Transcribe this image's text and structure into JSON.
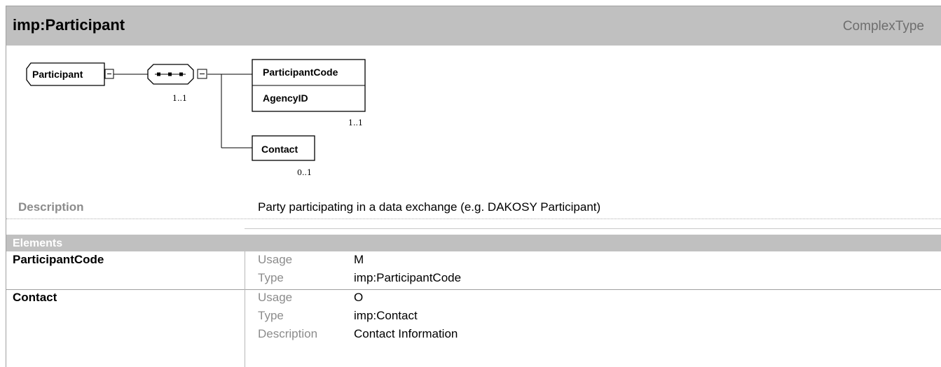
{
  "header": {
    "title": "imp:Participant",
    "kind": "ComplexType"
  },
  "diagram": {
    "root_label": "Participant",
    "sequence_cardinality": "1..1",
    "group_items": [
      "ParticipantCode",
      "AgencyID"
    ],
    "group_cardinality": "1..1",
    "contact_label": "Contact",
    "contact_cardinality": "0..1"
  },
  "description": {
    "label": "Description",
    "text": "Party participating in a data exchange (e.g. DAKOSY Participant)"
  },
  "elements": {
    "heading": "Elements",
    "rows": [
      {
        "name": "ParticipantCode",
        "props": [
          {
            "key": "Usage",
            "value": "M"
          },
          {
            "key": "Type",
            "value": "imp:ParticipantCode"
          }
        ]
      },
      {
        "name": "Contact",
        "props": [
          {
            "key": "Usage",
            "value": "O"
          },
          {
            "key": "Type",
            "value": "imp:Contact"
          },
          {
            "key": "Description",
            "value": "Contact Information"
          }
        ]
      }
    ]
  }
}
